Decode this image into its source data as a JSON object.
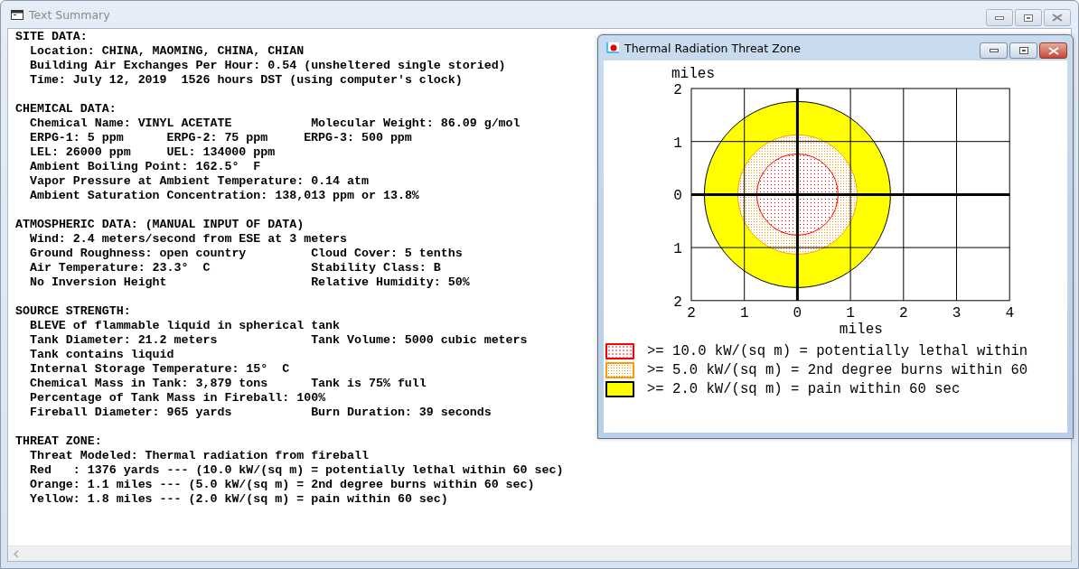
{
  "window": {
    "title": "Text Summary"
  },
  "sections": [
    {
      "heading": "SITE DATA:",
      "lines": [
        {
          "cells": [
            "Location: CHINA, MAOMING, CHINA, CHIAN"
          ]
        },
        {
          "cells": [
            "Building Air Exchanges Per Hour: 0.54 (unsheltered single storied)"
          ]
        },
        {
          "cells": [
            "Time: July 12, 2019  1526 hours DST (using computer's clock)"
          ]
        }
      ]
    },
    {
      "heading": "CHEMICAL DATA:",
      "lines": [
        {
          "cells": [
            "Chemical Name: VINYL ACETATE",
            "Molecular Weight: 86.09 g/mol"
          ]
        },
        {
          "cells": [
            "ERPG-1: 5 ppm",
            "ERPG-2: 75 ppm",
            "ERPG-3: 500 ppm"
          ],
          "kind": "grid"
        },
        {
          "cells": [
            "LEL: 26000 ppm",
            "UEL: 134000 ppm"
          ],
          "kind": "grid"
        },
        {
          "cells": [
            "Ambient Boiling Point: 162.5°  F"
          ]
        },
        {
          "cells": [
            "Vapor Pressure at Ambient Temperature: 0.14 atm"
          ]
        },
        {
          "cells": [
            "Ambient Saturation Concentration: 138,013 ppm or 13.8%"
          ]
        }
      ]
    },
    {
      "heading": "ATMOSPHERIC DATA: (MANUAL INPUT OF DATA)",
      "lines": [
        {
          "cells": [
            "Wind: 2.4 meters/second from ESE at 3 meters"
          ]
        },
        {
          "cells": [
            "Ground Roughness: open country",
            "Cloud Cover: 5 tenths"
          ]
        },
        {
          "cells": [
            "Air Temperature: 23.3°  C",
            "Stability Class: B"
          ]
        },
        {
          "cells": [
            "No Inversion Height",
            "Relative Humidity: 50%"
          ]
        }
      ]
    },
    {
      "heading": "SOURCE STRENGTH:",
      "lines": [
        {
          "cells": [
            "BLEVE of flammable liquid in spherical tank"
          ]
        },
        {
          "cells": [
            "Tank Diameter: 21.2 meters",
            "Tank Volume: 5000 cubic meters"
          ]
        },
        {
          "cells": [
            "Tank contains liquid"
          ]
        },
        {
          "cells": [
            "Internal Storage Temperature: 15°  C"
          ]
        },
        {
          "cells": [
            "Chemical Mass in Tank: 3,879 tons",
            "Tank is 75% full"
          ]
        },
        {
          "cells": [
            "Percentage of Tank Mass in Fireball: 100%"
          ]
        },
        {
          "cells": [
            "Fireball Diameter: 965 yards",
            "Burn Duration: 39 seconds"
          ]
        }
      ]
    },
    {
      "heading": "THREAT ZONE:",
      "lines": [
        {
          "cells": [
            "Threat Modeled: Thermal radiation from fireball"
          ]
        },
        {
          "cells": [
            "Red   : 1376 yards --- (10.0 kW/(sq m) = potentially lethal within 60 sec)"
          ]
        },
        {
          "cells": [
            "Orange: 1.1 miles --- (5.0 kW/(sq m) = 2nd degree burns within 60 sec)"
          ]
        },
        {
          "cells": [
            "Yellow: 1.8 miles --- (2.0 kW/(sq m) = pain within 60 sec)"
          ]
        }
      ]
    }
  ],
  "plot_window": {
    "title": "Thermal Radiation Threat Zone",
    "ylabel": "miles",
    "xlabel": "miles",
    "y_ticks": [
      "2",
      "1",
      "0",
      "1",
      "2"
    ],
    "x_ticks": [
      "2",
      "1",
      "0",
      "1",
      "2",
      "3",
      "4"
    ],
    "legend": [
      {
        "text": ">= 10.0 kW/(sq m) = potentially lethal within",
        "color": "#ff0000",
        "kind": "dotted"
      },
      {
        "text": ">= 5.0 kW/(sq m) = 2nd degree burns within 60",
        "color": "#ff9900",
        "kind": "dotted"
      },
      {
        "text": ">= 2.0 kW/(sq m) = pain within 60 sec",
        "color": "#ffff00",
        "kind": "solid"
      }
    ]
  }
}
